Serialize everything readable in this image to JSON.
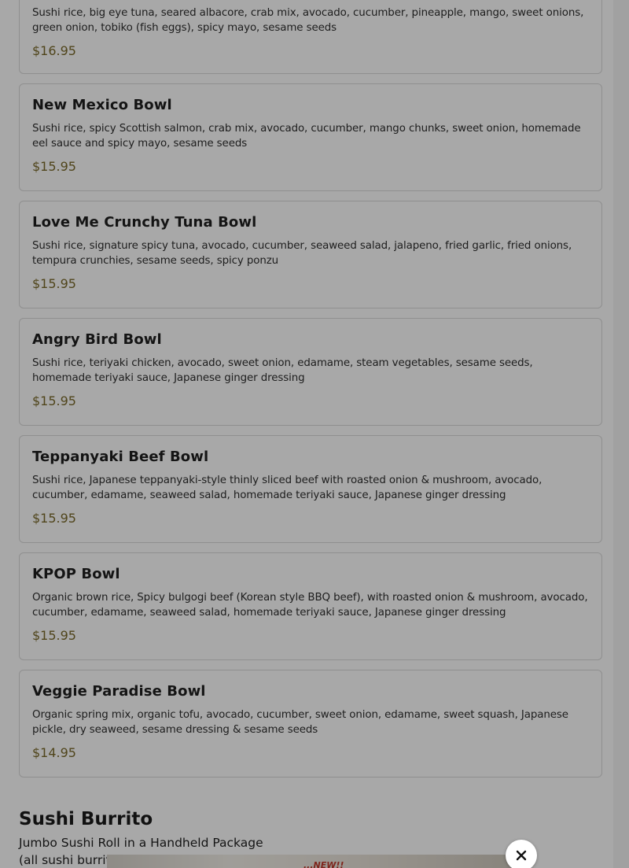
{
  "menu": {
    "items": [
      {
        "name": "",
        "description": "Sushi rice, big eye tuna, seared albacore, crab mix, avocado, cucumber, pineapple, mango, sweet onions, green onion, tobiko (fish eggs), spicy mayo, sesame seeds",
        "price": "$16.95"
      },
      {
        "name": "New Mexico Bowl",
        "description": "Sushi rice, spicy Scottish salmon, crab mix, avocado, cucumber, mango chunks, sweet onion, homemade eel sauce and spicy mayo, sesame seeds",
        "price": "$15.95"
      },
      {
        "name": "Love Me Crunchy Tuna Bowl",
        "description": "Sushi rice, signature spicy tuna, avocado, cucumber, seaweed salad, jalapeno, fried garlic, fried onions, tempura crunchies, sesame seeds, spicy ponzu",
        "price": "$15.95"
      },
      {
        "name": "Angry Bird Bowl",
        "description": "Sushi rice, teriyaki chicken, avocado, sweet onion, edamame, steam vegetables, sesame seeds, homemade teriyaki sauce, Japanese ginger dressing",
        "price": "$15.95"
      },
      {
        "name": "Teppanyaki Beef Bowl",
        "description": "Sushi rice, Japanese teppanyaki-style thinly sliced beef with roasted onion & mushroom, avocado, cucumber, edamame, seaweed salad, homemade teriyaki sauce, Japanese ginger dressing",
        "price": "$15.95"
      },
      {
        "name": "KPOP Bowl",
        "description": "Organic brown rice, Spicy bulgogi beef (Korean style BBQ beef), with roasted onion & mushroom, avocado, cucumber, edamame, seaweed salad, homemade teriyaki sauce, Japanese ginger dressing",
        "price": "$15.95"
      },
      {
        "name": "Veggie Paradise Bowl",
        "description": "Organic spring mix, organic tofu, avocado, cucumber, sweet onion, edamame, sweet squash, Japanese pickle, dry seaweed, sesame dressing & sesame seeds",
        "price": "$14.95"
      }
    ]
  },
  "section": {
    "title": "Sushi Burrito",
    "subtitle": "Jumbo Sushi Roll in a Handheld Package",
    "subtitle2": "(all sushi burrito"
  },
  "preview": {
    "scribble_text": "...NEW!!"
  },
  "modal": {
    "close_icon": "close-icon",
    "overlay_color": "rgba(0,0,0,0.34)"
  },
  "colors": {
    "price": "#7a6a2a"
  }
}
